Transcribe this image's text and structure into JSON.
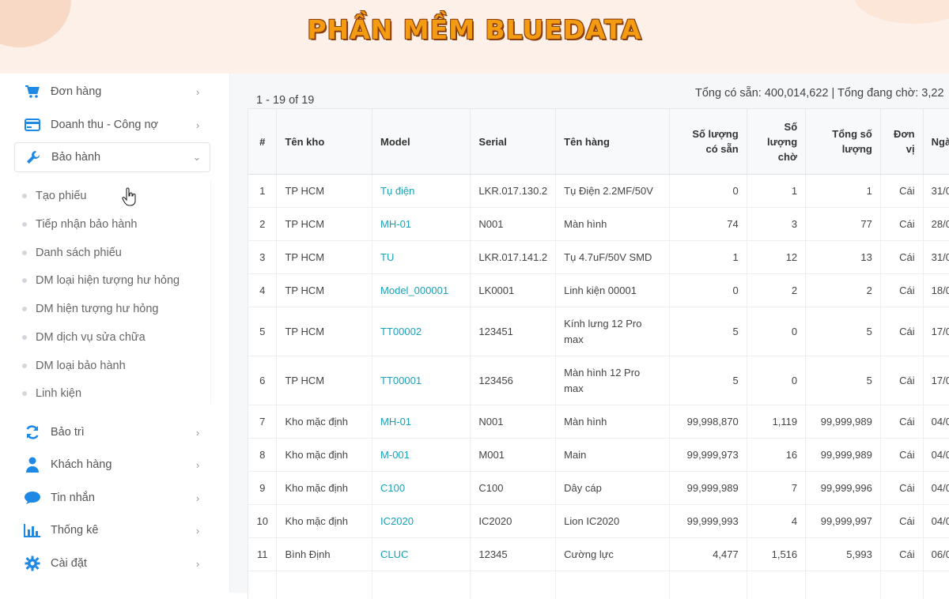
{
  "banner": {
    "title": "PHẦN MỀM BLUEDATA"
  },
  "sidebar": {
    "items_top": [
      {
        "label": "Đơn hàng",
        "icon": "cart-icon"
      },
      {
        "label": "Doanh thu - Công nợ",
        "icon": "credit-card-icon"
      },
      {
        "label": "Bảo hành",
        "icon": "wrench-icon",
        "expanded": true
      }
    ],
    "submenu": [
      {
        "label": "Tạo phiếu"
      },
      {
        "label": "Tiếp nhận bảo hành"
      },
      {
        "label": "Danh sách phiếu"
      },
      {
        "label": "DM loại hiện tượng hư hỏng"
      },
      {
        "label": "DM hiện tượng hư hỏng"
      },
      {
        "label": "DM dịch vụ sửa chữa"
      },
      {
        "label": "DM loại bảo hành"
      },
      {
        "label": "Linh kiện"
      }
    ],
    "items_bottom": [
      {
        "label": "Bảo trì",
        "icon": "refresh-icon"
      },
      {
        "label": "Khách hàng",
        "icon": "user-icon"
      },
      {
        "label": "Tin nhắn",
        "icon": "chat-icon"
      },
      {
        "label": "Thống kê",
        "icon": "bar-chart-icon"
      },
      {
        "label": "Cài đặt",
        "icon": "gear-icon"
      }
    ]
  },
  "main": {
    "pager": "1 - 19 of 19",
    "totals": "Tổng có sẵn: 400,014,622 | Tổng đang chờ: 3,22",
    "table": {
      "headers": [
        "#",
        "Tên kho",
        "Model",
        "Serial",
        "Tên hàng",
        "Số lượng có sẵn",
        "Số lượng chờ",
        "Tổng số lượng",
        "Đơn vị",
        "Ngà"
      ],
      "rows": [
        [
          "1",
          "TP HCM",
          "Tụ điện",
          "LKR.017.130.2",
          "Tụ Điện 2.2MF/50V",
          "0",
          "1",
          "1",
          "Cái",
          "31/0"
        ],
        [
          "2",
          "TP HCM",
          "MH-01",
          "N001",
          "Màn hình",
          "74",
          "3",
          "77",
          "Cái",
          "28/0"
        ],
        [
          "3",
          "TP HCM",
          "TU",
          "LKR.017.141.2",
          "Tụ 4.7uF/50V SMD",
          "1",
          "12",
          "13",
          "Cái",
          "31/0"
        ],
        [
          "4",
          "TP HCM",
          "Model_000001",
          "LK0001",
          "Linh kiện 00001",
          "0",
          "2",
          "2",
          "Cái",
          "18/0"
        ],
        [
          "5",
          "TP HCM",
          "TT00002",
          "123451",
          "Kính lưng 12 Pro max",
          "5",
          "0",
          "5",
          "Cái",
          "17/0"
        ],
        [
          "6",
          "TP HCM",
          "TT00001",
          "123456",
          "Màn hình 12 Pro max",
          "5",
          "0",
          "5",
          "Cái",
          "17/0"
        ],
        [
          "7",
          "Kho mặc định",
          "MH-01",
          "N001",
          "Màn hình",
          "99,998,870",
          "1,119",
          "99,999,989",
          "Cái",
          "04/0"
        ],
        [
          "8",
          "Kho mặc định",
          "M-001",
          "M001",
          "Main",
          "99,999,973",
          "16",
          "99,999,989",
          "Cái",
          "04/0"
        ],
        [
          "9",
          "Kho mặc định",
          "C100",
          "C100",
          "Dây cáp",
          "99,999,989",
          "7",
          "99,999,996",
          "Cái",
          "04/0"
        ],
        [
          "10",
          "Kho mặc định",
          "IC2020",
          "IC2020",
          "Lion IC2020",
          "99,999,993",
          "4",
          "99,999,997",
          "Cái",
          "04/0"
        ],
        [
          "11",
          "Bình Định",
          "CLUC",
          "12345",
          "Cường lực",
          "4,477",
          "1,516",
          "5,993",
          "Cái",
          "06/0"
        ],
        [
          "",
          "",
          "",
          "",
          "",
          "",
          "",
          "",
          "",
          ""
        ]
      ]
    }
  },
  "colors": {
    "banner_text": "#f39c12",
    "link": "#17a2b8",
    "icon_blue": "#1e88e5"
  }
}
